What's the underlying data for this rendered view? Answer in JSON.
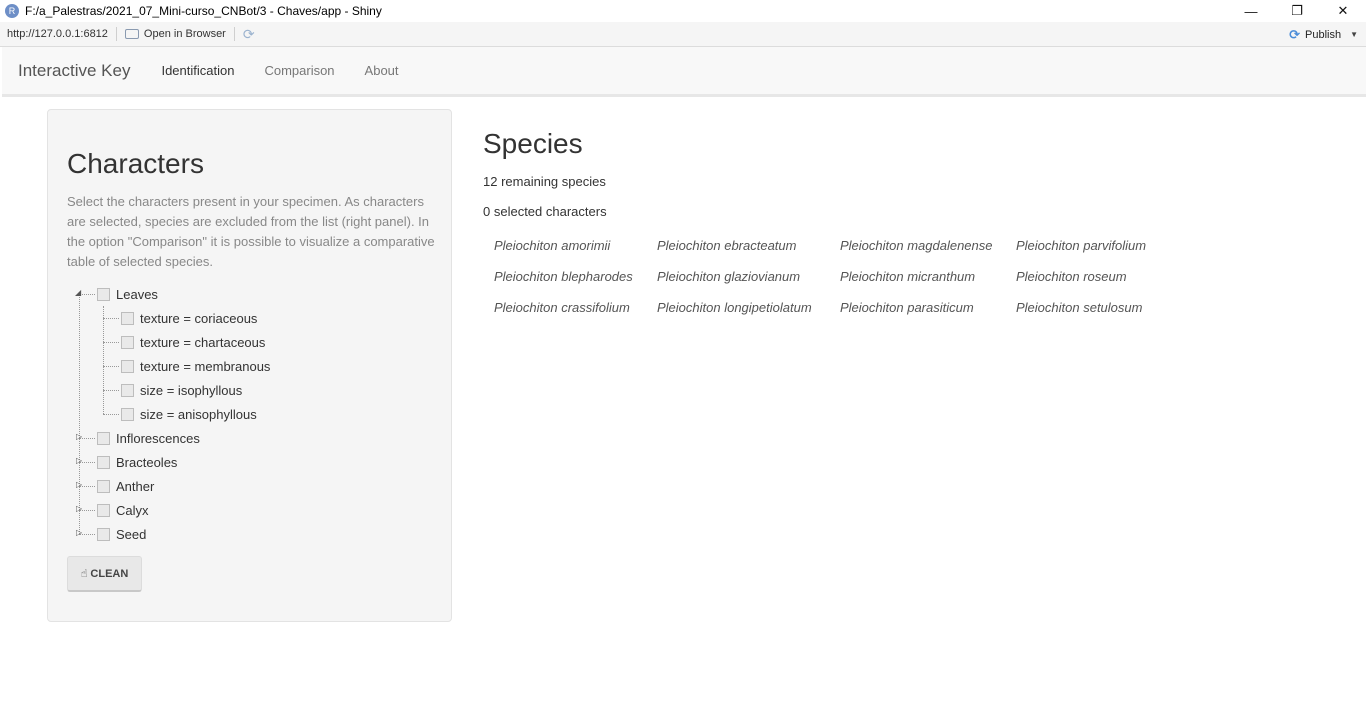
{
  "window": {
    "title": "F:/a_Palestras/2021_07_Mini-curso_CNBot/3 - Chaves/app - Shiny",
    "app_icon_letter": "R"
  },
  "viewer": {
    "url": "http://127.0.0.1:6812",
    "open_in_browser": "Open in Browser",
    "publish": "Publish"
  },
  "navbar": {
    "brand": "Interactive Key",
    "tabs": [
      {
        "label": "Identification",
        "active": true
      },
      {
        "label": "Comparison",
        "active": false
      },
      {
        "label": "About",
        "active": false
      }
    ]
  },
  "characters": {
    "title": "Characters",
    "description": "Select the characters present in your specimen. As characters are selected, species are excluded from the list (right panel). In the option \"Comparison\" it is possible to visualize a comparative table of selected species.",
    "tree": [
      {
        "label": "Leaves",
        "expanded": true,
        "children": [
          "texture = coriaceous",
          "texture = chartaceous",
          "texture = membranous",
          "size = isophyllous",
          "size = anisophyllous"
        ]
      },
      {
        "label": "Inflorescences",
        "expanded": false
      },
      {
        "label": "Bracteoles",
        "expanded": false
      },
      {
        "label": "Anther",
        "expanded": false
      },
      {
        "label": "Calyx",
        "expanded": false
      },
      {
        "label": "Seed",
        "expanded": false
      }
    ],
    "clean_button": "CLEAN"
  },
  "species": {
    "title": "Species",
    "remaining": "12 remaining species",
    "selected": "0 selected characters",
    "columns": [
      [
        "Pleiochiton amorimii",
        "Pleiochiton blepharodes",
        "Pleiochiton crassifolium"
      ],
      [
        "Pleiochiton ebracteatum",
        "Pleiochiton glaziovianum",
        "Pleiochiton longipetiolatum"
      ],
      [
        "Pleiochiton magdalenense",
        "Pleiochiton micranthum",
        "Pleiochiton parasiticum"
      ],
      [
        "Pleiochiton parvifolium",
        "Pleiochiton roseum",
        "Pleiochiton setulosum"
      ]
    ]
  }
}
